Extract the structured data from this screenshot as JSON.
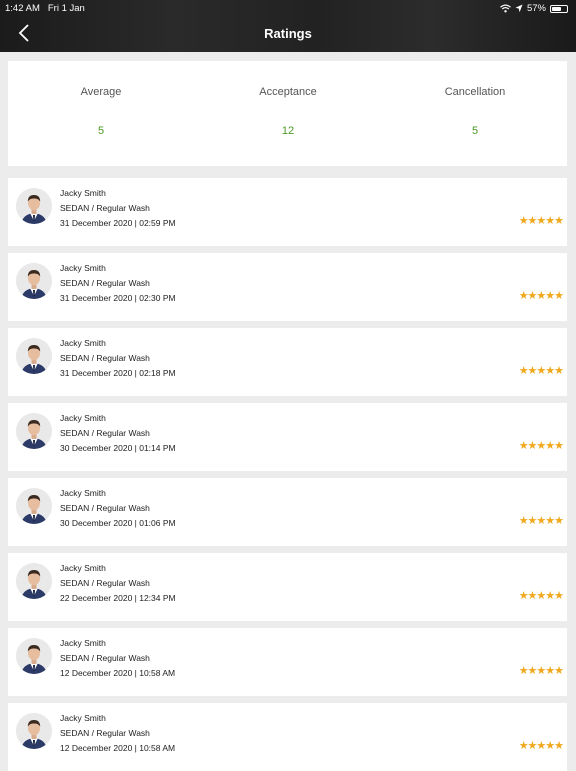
{
  "status_bar": {
    "time": "1:42 AM",
    "date": "Fri 1 Jan",
    "battery": "57%",
    "battery_level": 0.57
  },
  "header": {
    "title": "Ratings"
  },
  "summary": {
    "average": {
      "label": "Average",
      "value": "5"
    },
    "acceptance": {
      "label": "Acceptance",
      "value": "12"
    },
    "cancellation": {
      "label": "Cancellation",
      "value": "5"
    }
  },
  "ratings": [
    {
      "name": "Jacky Smith",
      "service": "SEDAN / Regular Wash",
      "datetime": "31 December 2020 | 02:59 PM",
      "stars": "★★★★★"
    },
    {
      "name": "Jacky Smith",
      "service": "SEDAN / Regular Wash",
      "datetime": "31 December 2020 | 02:30 PM",
      "stars": "★★★★★"
    },
    {
      "name": "Jacky Smith",
      "service": "SEDAN / Regular Wash",
      "datetime": "31 December 2020 | 02:18 PM",
      "stars": "★★★★★"
    },
    {
      "name": "Jacky Smith",
      "service": "SEDAN / Regular Wash",
      "datetime": "30 December 2020 | 01:14 PM",
      "stars": "★★★★★"
    },
    {
      "name": "Jacky Smith",
      "service": "SEDAN / Regular Wash",
      "datetime": "30 December 2020 | 01:06 PM",
      "stars": "★★★★★"
    },
    {
      "name": "Jacky Smith",
      "service": "SEDAN / Regular Wash",
      "datetime": "22 December 2020 | 12:34 PM",
      "stars": "★★★★★"
    },
    {
      "name": "Jacky Smith",
      "service": "SEDAN / Regular Wash",
      "datetime": "12 December 2020 | 10:58 AM",
      "stars": "★★★★★"
    },
    {
      "name": "Jacky Smith",
      "service": "SEDAN / Regular Wash",
      "datetime": "12 December 2020 | 10:58 AM",
      "stars": "★★★★★"
    }
  ],
  "colors": {
    "accent_green": "#4a9a27",
    "star": "#f0a81c",
    "header_bg": "#222222"
  }
}
